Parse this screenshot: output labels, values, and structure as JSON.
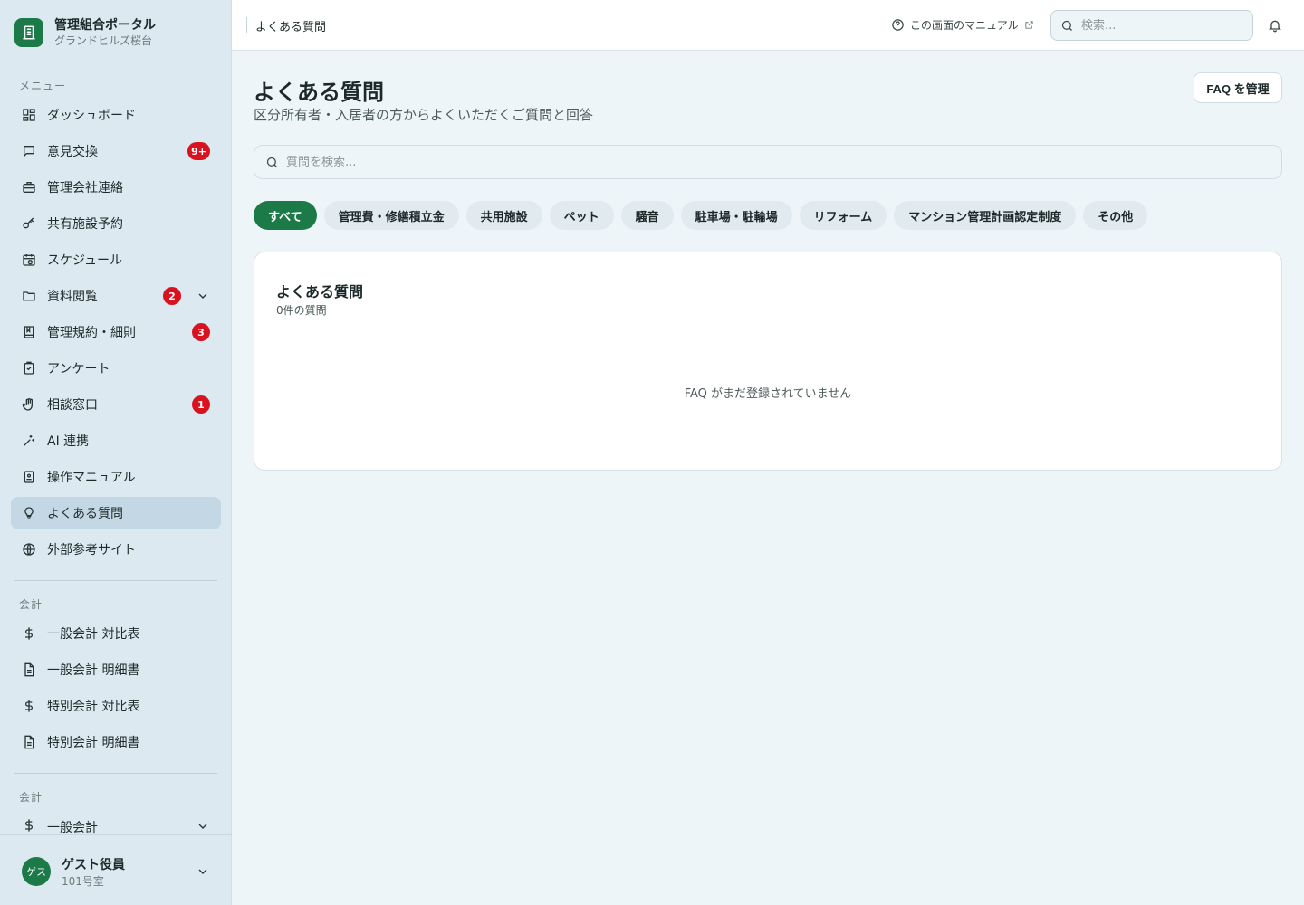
{
  "brand": {
    "title": "管理組合ポータル",
    "subtitle": "グランドヒルズ桜台"
  },
  "sidebar": {
    "menu_label": "メニュー",
    "items": [
      {
        "label": "ダッシュボード",
        "icon": "dashboard-icon"
      },
      {
        "label": "意見交換",
        "icon": "chat-icon",
        "badge": "9+"
      },
      {
        "label": "管理会社連絡",
        "icon": "briefcase-icon"
      },
      {
        "label": "共有施設予約",
        "icon": "key-icon"
      },
      {
        "label": "スケジュール",
        "icon": "calendar-clock-icon"
      },
      {
        "label": "資料閲覧",
        "icon": "folder-icon",
        "badge": "2",
        "expandable": true
      },
      {
        "label": "管理規約・細則",
        "icon": "book-icon",
        "badge": "3"
      },
      {
        "label": "アンケート",
        "icon": "clipboard-icon"
      },
      {
        "label": "相談窓口",
        "icon": "hand-icon",
        "badge": "1"
      },
      {
        "label": "AI 連携",
        "icon": "sparkle-icon"
      },
      {
        "label": "操作マニュアル",
        "icon": "manual-icon"
      },
      {
        "label": "よくある質問",
        "icon": "lightbulb-icon",
        "active": true
      },
      {
        "label": "外部参考サイト",
        "icon": "globe-icon"
      }
    ],
    "accounting_label": "会計",
    "accounting_items": [
      {
        "label": "一般会計 対比表",
        "icon": "dollar-icon"
      },
      {
        "label": "一般会計 明細書",
        "icon": "document-icon"
      },
      {
        "label": "特別会計 対比表",
        "icon": "dollar-icon"
      },
      {
        "label": "特別会計 明細書",
        "icon": "document-icon"
      }
    ],
    "accounting2_label": "会計",
    "accounting2_items": [
      {
        "label": "一般会計",
        "icon": "dollar-icon",
        "expandable": true
      }
    ]
  },
  "user": {
    "avatar": "ゲス",
    "name": "ゲスト役員",
    "room": "101号室"
  },
  "header": {
    "breadcrumb": "よくある質問",
    "manual_link": "この画面のマニュアル",
    "search_placeholder": "検索..."
  },
  "main": {
    "title": "よくある質問",
    "subtitle": "区分所有者・入居者の方からよくいただくご質問と回答",
    "manage_button": "FAQ を管理",
    "search_placeholder": "質問を検索...",
    "categories": [
      {
        "label": "すべて",
        "active": true
      },
      {
        "label": "管理費・修繕積立金"
      },
      {
        "label": "共用施設"
      },
      {
        "label": "ペット"
      },
      {
        "label": "騒音"
      },
      {
        "label": "駐車場・駐輪場"
      },
      {
        "label": "リフォーム"
      },
      {
        "label": "マンション管理計画認定制度"
      },
      {
        "label": "その他"
      }
    ],
    "card": {
      "title": "よくある質問",
      "count": "0件の質問",
      "empty": "FAQ がまだ登録されていません"
    }
  },
  "colors": {
    "accent": "#1b7a47",
    "badge": "#d9121f",
    "sidebar_bg": "#dce9f1",
    "page_bg": "#eef5f8"
  }
}
